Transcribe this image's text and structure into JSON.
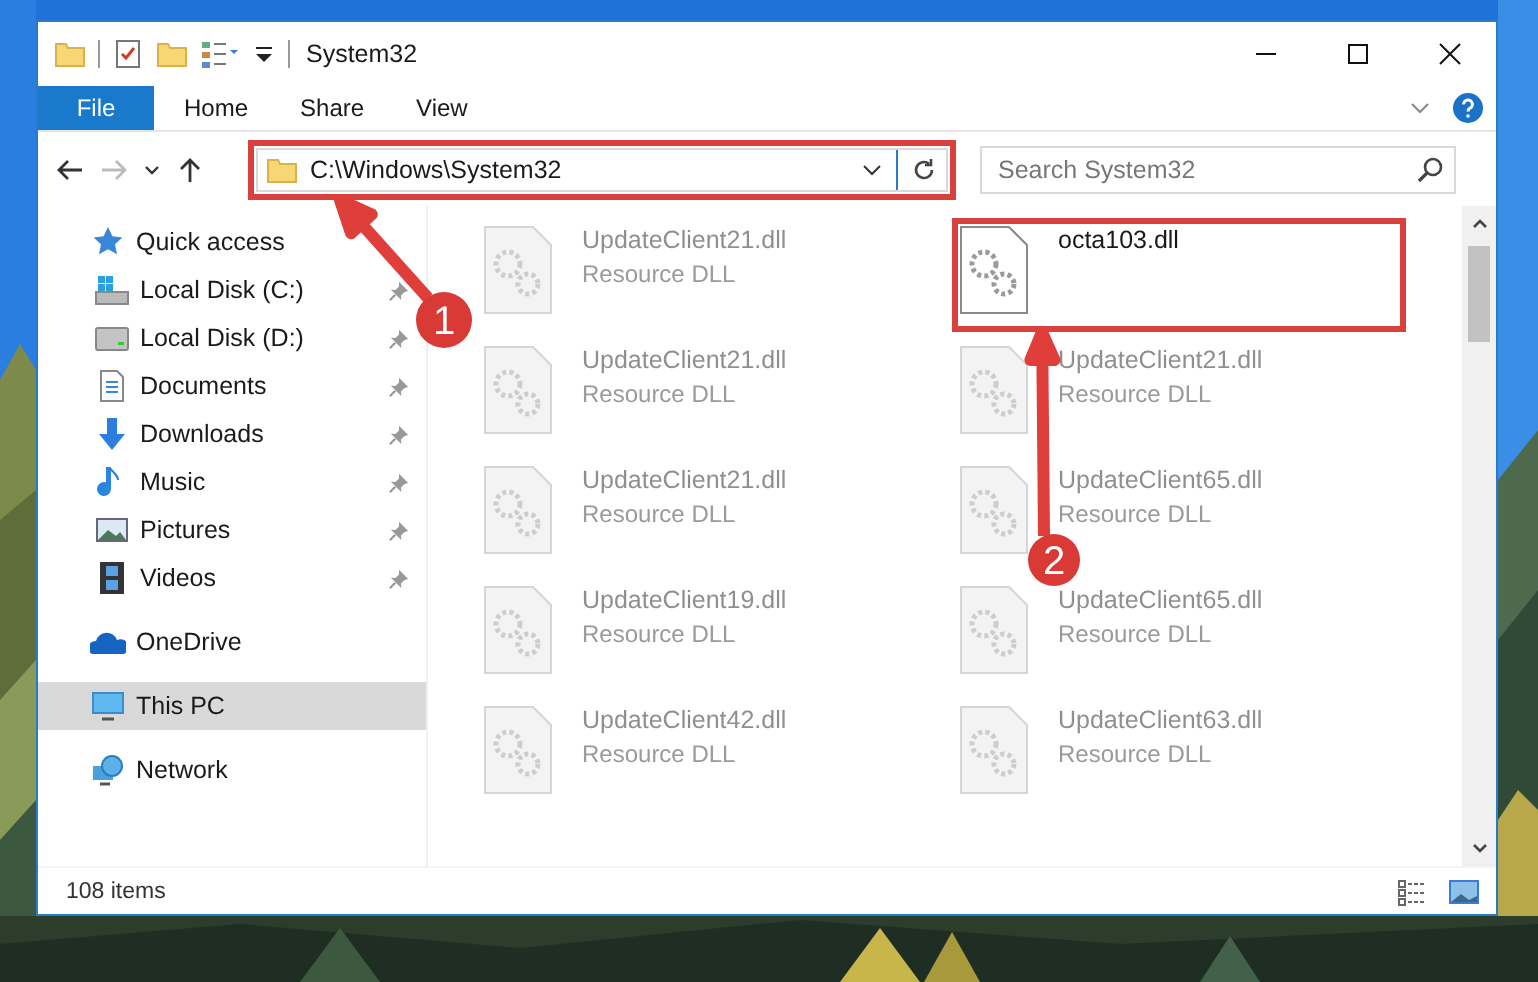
{
  "window": {
    "title": "System32"
  },
  "ribbon": {
    "tabs": [
      {
        "label": "File",
        "kind": "file"
      },
      {
        "label": "Home",
        "kind": "tab"
      },
      {
        "label": "Share",
        "kind": "tab"
      },
      {
        "label": "View",
        "kind": "tab"
      }
    ]
  },
  "nav_buttons": [
    {
      "kind": "back",
      "disabled": false
    },
    {
      "kind": "forward",
      "disabled": true
    },
    {
      "kind": "recent",
      "disabled": false
    },
    {
      "kind": "up",
      "disabled": false
    }
  ],
  "address_bar": {
    "path": "C:\\Windows\\System32",
    "highlighted": true
  },
  "search": {
    "placeholder": "Search System32"
  },
  "sidebar": {
    "items": [
      {
        "label": "Quick access",
        "kind": "star",
        "selected": false,
        "children": [
          {
            "label": "Local Disk (C:)",
            "kind": "system-drive",
            "pinned": true,
            "selected": false
          },
          {
            "label": "Local Disk (D:)",
            "kind": "drive",
            "pinned": true,
            "selected": false
          },
          {
            "label": "Documents",
            "kind": "document",
            "pinned": true,
            "selected": false
          },
          {
            "label": "Downloads",
            "kind": "download",
            "pinned": true,
            "selected": false
          },
          {
            "label": "Music",
            "kind": "music",
            "pinned": true,
            "selected": false
          },
          {
            "label": "Pictures",
            "kind": "picture",
            "pinned": true,
            "selected": false
          },
          {
            "label": "Videos",
            "kind": "video",
            "pinned": true,
            "selected": false
          }
        ]
      },
      {
        "label": "OneDrive",
        "kind": "cloud",
        "selected": false
      },
      {
        "label": "This PC",
        "kind": "computer",
        "selected": true
      },
      {
        "label": "Network",
        "kind": "network",
        "selected": false
      }
    ]
  },
  "files": [
    {
      "name": "UpdateClient21.dll",
      "type": "Resource DLL",
      "faded": true,
      "highlighted": false
    },
    {
      "name": "octa103.dll",
      "faded": false,
      "highlighted": true
    },
    {
      "name": "UpdateClient21.dll",
      "type": "Resource DLL",
      "faded": true,
      "highlighted": false
    },
    {
      "name": "UpdateClient21.dll",
      "type": "Resource DLL",
      "faded": true,
      "highlighted": false
    },
    {
      "name": "UpdateClient21.dll",
      "type": "Resource DLL",
      "faded": true,
      "highlighted": false
    },
    {
      "name": "UpdateClient65.dll",
      "type": "Resource DLL",
      "faded": true,
      "highlighted": false
    },
    {
      "name": "UpdateClient19.dll",
      "type": "Resource DLL",
      "faded": true,
      "highlighted": false
    },
    {
      "name": "UpdateClient65.dll",
      "type": "Resource DLL",
      "faded": true,
      "highlighted": false
    },
    {
      "name": "UpdateClient42.dll",
      "type": "Resource DLL",
      "faded": true,
      "highlighted": false
    },
    {
      "name": "UpdateClient63.dll",
      "type": "Resource DLL",
      "faded": true,
      "highlighted": false
    }
  ],
  "status_bar": {
    "item_count": "108 items"
  },
  "annotations": [
    {
      "number": "1"
    },
    {
      "number": "2"
    }
  ]
}
